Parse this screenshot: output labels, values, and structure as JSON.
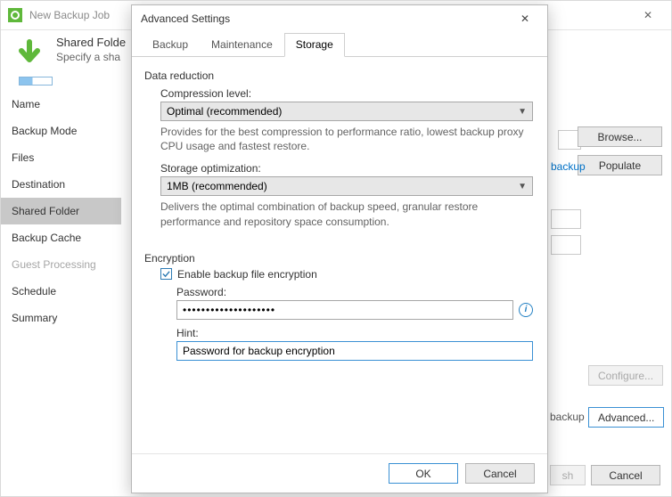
{
  "back": {
    "title": "New Backup Job",
    "header": {
      "line1": "Shared Folde",
      "line2": "Specify a sha"
    },
    "nav": [
      {
        "label": "Name",
        "dim": false,
        "sel": false
      },
      {
        "label": "Backup Mode",
        "dim": false,
        "sel": false
      },
      {
        "label": "Files",
        "dim": false,
        "sel": false
      },
      {
        "label": "Destination",
        "dim": false,
        "sel": false
      },
      {
        "label": "Shared Folder",
        "dim": false,
        "sel": true
      },
      {
        "label": "Backup Cache",
        "dim": false,
        "sel": false
      },
      {
        "label": "Guest Processing",
        "dim": true,
        "sel": false
      },
      {
        "label": "Schedule",
        "dim": false,
        "sel": false
      },
      {
        "label": "Summary",
        "dim": false,
        "sel": false
      }
    ],
    "right_buttons": {
      "browse": "Browse...",
      "populate": "Populate"
    },
    "link": "backup",
    "label_backup": "backup",
    "config_btn": "Configure...",
    "advanced_btn": "Advanced...",
    "footer": {
      "finish": "sh",
      "cancel": "Cancel"
    }
  },
  "modal": {
    "title": "Advanced Settings",
    "tabs": {
      "backup": "Backup",
      "maintenance": "Maintenance",
      "storage": "Storage"
    },
    "data_reduction": {
      "legend": "Data reduction",
      "compression_label": "Compression level:",
      "compression_value": "Optimal (recommended)",
      "compression_help": "Provides for the best compression to performance ratio, lowest backup proxy CPU usage and fastest restore.",
      "storage_label": "Storage optimization:",
      "storage_value": "1MB (recommended)",
      "storage_help": "Delivers the optimal combination of backup speed, granular restore performance and repository space consumption."
    },
    "encryption": {
      "legend": "Encryption",
      "enable_label": "Enable backup file encryption",
      "enabled": true,
      "password_label": "Password:",
      "password_mask": "••••••••••••••••••••",
      "hint_label": "Hint:",
      "hint_value": "Password for backup encryption"
    },
    "footer": {
      "ok": "OK",
      "cancel": "Cancel"
    }
  }
}
